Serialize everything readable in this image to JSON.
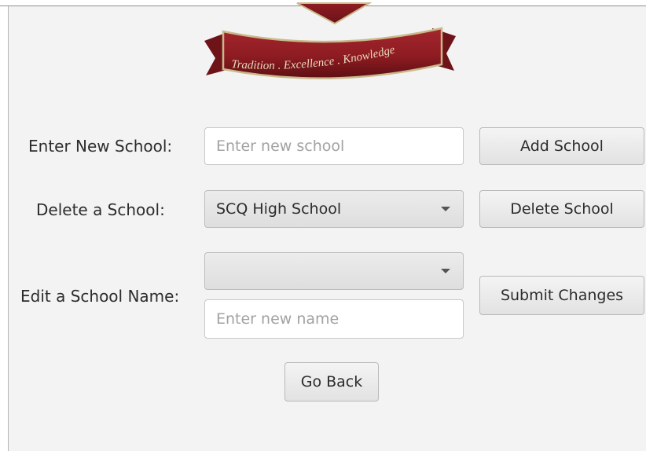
{
  "logo": {
    "motto": "Tradition . Excellence . Knowledge",
    "colors": {
      "ribbon": "#8e1c22",
      "ribbon_dark": "#5e0f14",
      "trim": "#c9b98a"
    }
  },
  "add_school": {
    "label": "Enter New School:",
    "placeholder": "Enter new school",
    "button_label": "Add School"
  },
  "delete_school": {
    "label": "Delete a School:",
    "selected_value": "SCQ High School",
    "button_label": "Delete School"
  },
  "edit_school": {
    "label": "Edit a School Name:",
    "selected_value": "",
    "placeholder": "Enter new name",
    "button_label": "Submit Changes"
  },
  "navigation": {
    "back_label": "Go Back"
  },
  "icons": {
    "dropdown": "chevron-down-icon"
  }
}
